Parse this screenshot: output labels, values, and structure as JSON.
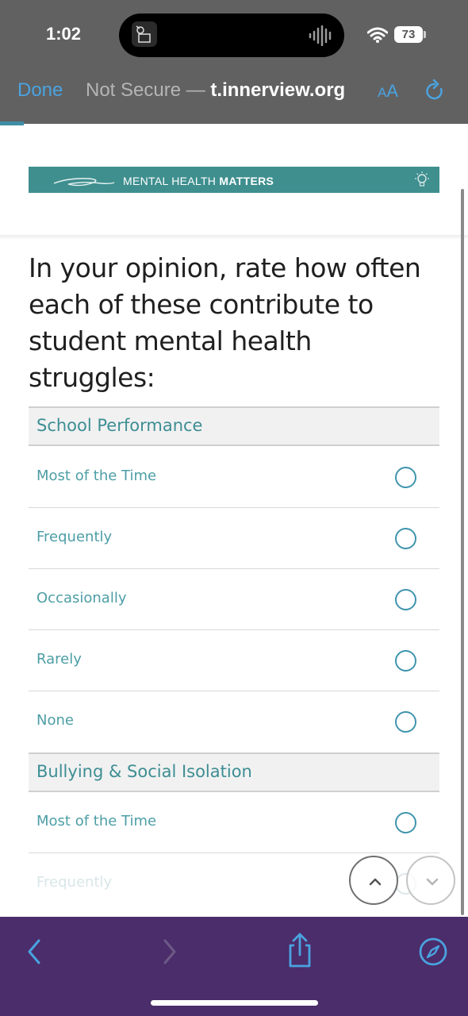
{
  "status_bar": {
    "time": "1:02",
    "battery": "73"
  },
  "browser": {
    "done_label": "Done",
    "url_prefix": "Not Secure — ",
    "url_domain": "t.innerview.org",
    "aa_label_small": "A",
    "aa_label_large": "A"
  },
  "banner": {
    "text_regular": "MENTAL HEALTH",
    "text_bold": "MATTERS"
  },
  "question": "In your opinion, rate how often each of these contribute to student mental health struggles:",
  "sections": [
    {
      "label": "School Performance",
      "options": [
        "Most of the Time",
        "Frequently",
        "Occasionally",
        "Rarely",
        "None"
      ]
    },
    {
      "label": "Bullying & Social Isolation",
      "options": [
        "Most of the Time",
        "Frequently"
      ]
    }
  ],
  "colors": {
    "accent_teal": "#3d8e94",
    "banner_bg": "#3f8f8f",
    "toolbar_bg": "#4a2d6a",
    "link_blue": "#4aa3e0"
  },
  "icons": [
    "app-icon",
    "audio-wave-icon",
    "wifi-icon",
    "reload-icon",
    "signature-logo-icon",
    "lightbulb-icon",
    "chevron-up-icon",
    "chevron-down-icon",
    "back-icon",
    "forward-icon",
    "share-icon",
    "compass-icon"
  ]
}
